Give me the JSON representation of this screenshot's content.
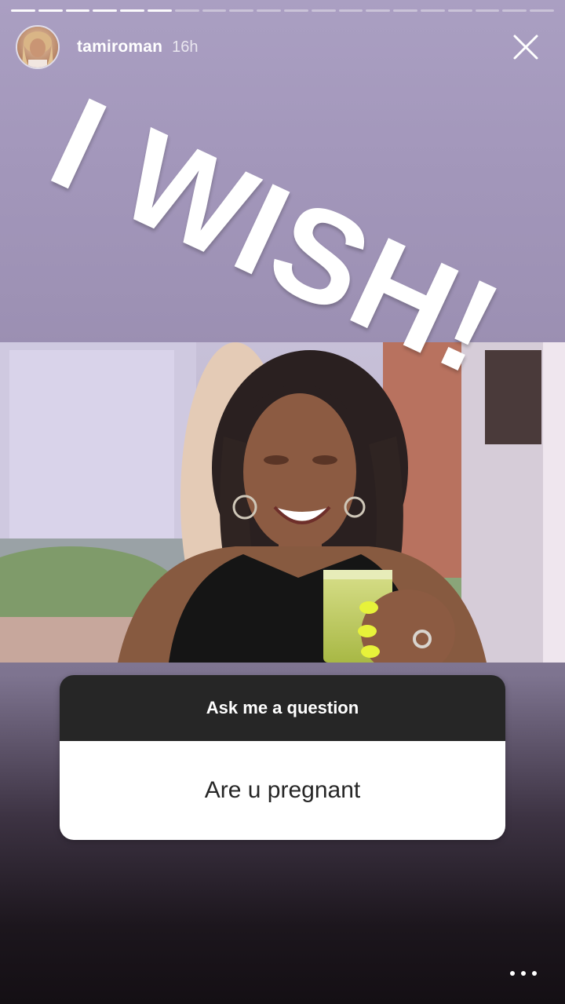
{
  "story": {
    "progress": {
      "total_segments": 20,
      "viewed_segments": 6
    },
    "header": {
      "username": "tamiroman",
      "timestamp": "16h",
      "close_icon": "close-icon"
    },
    "sticker_text": "I WISH!",
    "question_sticker": {
      "prompt": "Ask me a question",
      "answer": "Are u pregnant"
    },
    "more_icon": "more-options-icon"
  },
  "colors": {
    "top_background": "#aa9fc2",
    "bottom_background": "#140f14",
    "question_header": "#262626",
    "question_body": "#ffffff"
  }
}
